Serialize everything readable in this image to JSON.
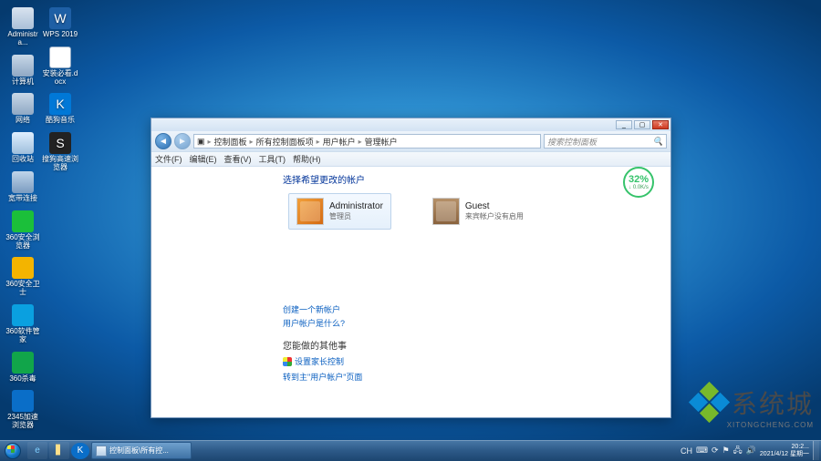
{
  "desktop_icons_col1": [
    {
      "name": "administrator",
      "label": "Administra...",
      "icon": "ico-user"
    },
    {
      "name": "computer",
      "label": "计算机",
      "icon": "ico-comp"
    },
    {
      "name": "network",
      "label": "网络",
      "icon": "ico-net"
    },
    {
      "name": "recycle-bin",
      "label": "回收站",
      "icon": "ico-bin"
    },
    {
      "name": "remote-desktop",
      "label": "宽带连接",
      "icon": "ico-remote"
    },
    {
      "name": "360-browser",
      "label": "360安全浏览器",
      "icon": "ico-360b"
    },
    {
      "name": "360-guard",
      "label": "360安全卫士",
      "icon": "ico-360s"
    },
    {
      "name": "360-soft",
      "label": "360软件管家",
      "icon": "ico-360t"
    },
    {
      "name": "tencent-mgr",
      "label": "360杀毒",
      "icon": "ico-tm"
    },
    {
      "name": "quick-bro",
      "label": "2345加速浏览器",
      "icon": "ico-blue"
    }
  ],
  "desktop_icons_col2": [
    {
      "name": "wps",
      "label": "WPS 2019",
      "icon": "ico-wps",
      "glyph": "W"
    },
    {
      "name": "install-doc",
      "label": "安装必看.docx",
      "icon": "ico-doc"
    },
    {
      "name": "kugou",
      "label": "酷狗音乐",
      "icon": "ico-kg",
      "glyph": "K"
    },
    {
      "name": "sogou",
      "label": "搜狗高速浏览器",
      "icon": "ico-sogou",
      "glyph": "S"
    }
  ],
  "window": {
    "breadcrumb": {
      "root": "控制面板",
      "a": "所有控制面板项",
      "b": "用户帐户",
      "c": "管理帐户"
    },
    "search_placeholder": "搜索控制面板",
    "menus": [
      "文件(F)",
      "编辑(E)",
      "查看(V)",
      "工具(T)",
      "帮助(H)"
    ],
    "heading": "选择希望更改的帐户",
    "accounts": [
      {
        "name": "Administrator",
        "sub": "管理员"
      },
      {
        "name": "Guest",
        "sub": "来宾帐户没有启用"
      }
    ],
    "link_create": "创建一个新帐户",
    "link_what": "用户帐户是什么?",
    "other_heading": "您能做的其他事",
    "link_parental": "设置家长控制",
    "link_goto": "转到主\"用户帐户\"页面",
    "perf": {
      "pct": "32%",
      "rate": "↓ 0.0K/s"
    }
  },
  "taskbar": {
    "task_label": "控制面板\\所有控...",
    "ime": "CH",
    "kb": "⌨",
    "time": "20:2...",
    "date": "2021/4/12 星期一"
  },
  "watermark": {
    "text": "系统城",
    "sub": "XITONGCHENG.COM"
  }
}
